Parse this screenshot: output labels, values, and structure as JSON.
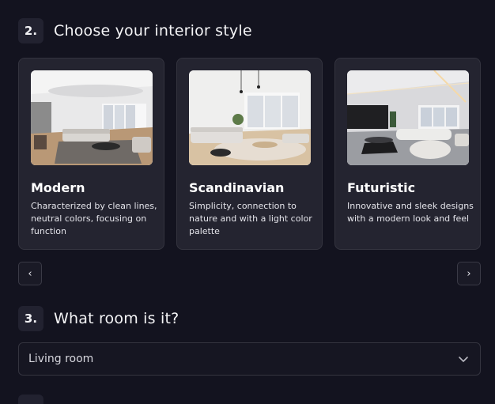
{
  "steps": [
    {
      "number": "2.",
      "title": "Choose your interior style"
    },
    {
      "number": "3.",
      "title": "What room is it?"
    }
  ],
  "styles": [
    {
      "name": "Modern",
      "description": "Characterized by clean lines, neutral colors, focusing on function"
    },
    {
      "name": "Scandinavian",
      "description": "Simplicity, connection to nature and with a light color palette"
    },
    {
      "name": "Futuristic",
      "description": "Innovative and sleek designs with a modern look and feel"
    }
  ],
  "carousel": {
    "prev_icon": "chevron-left-icon",
    "next_icon": "chevron-right-icon",
    "prev_glyph": "‹",
    "next_glyph": "›"
  },
  "room_select": {
    "value": "Living room",
    "icon": "chevron-down-icon"
  },
  "colors": {
    "background": "#13131f",
    "card": "#242430",
    "border": "#34343f"
  }
}
